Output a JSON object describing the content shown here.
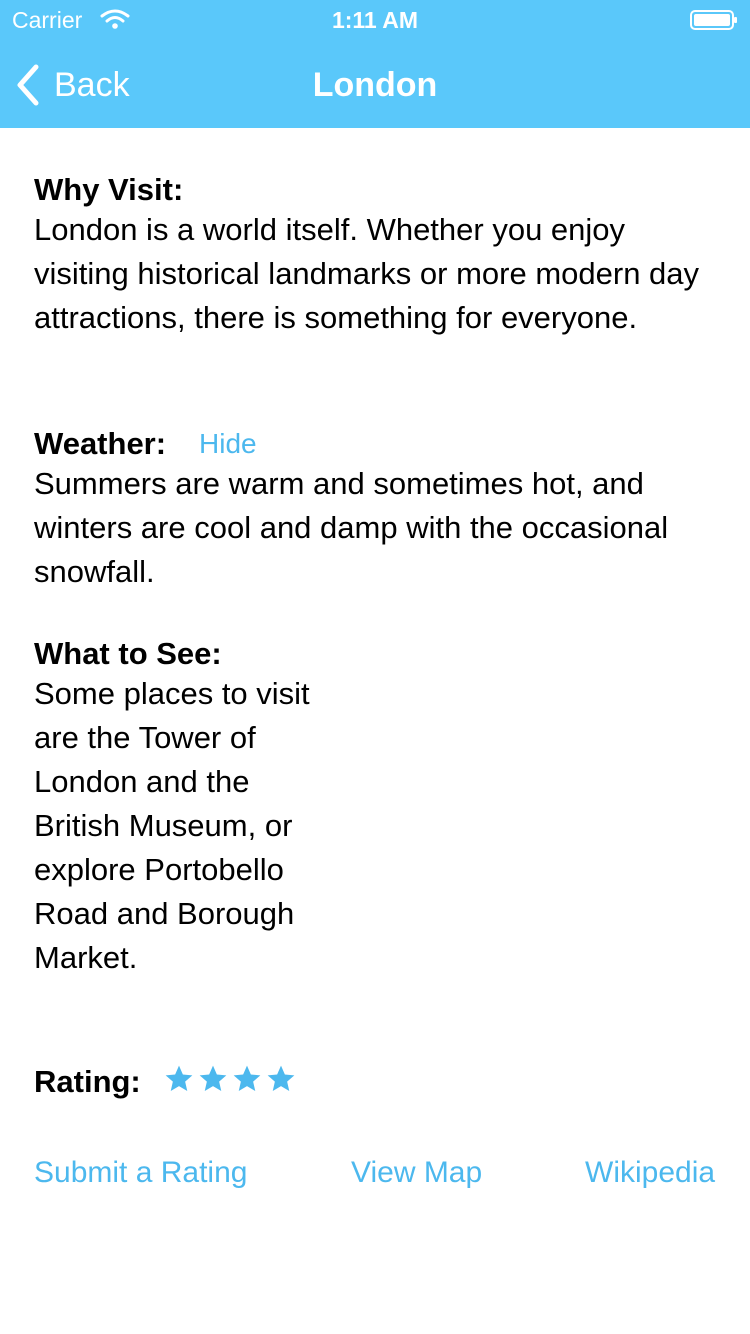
{
  "status_bar": {
    "carrier": "Carrier",
    "time": "1:11 AM",
    "wifi_icon": "wifi-icon",
    "battery_icon": "battery-icon"
  },
  "nav": {
    "back_label": "Back",
    "back_icon": "chevron-left-icon",
    "title": "London"
  },
  "sections": {
    "why_visit": {
      "heading": "Why Visit:",
      "text": "London is a world itself. Whether you enjoy visiting historical landmarks or more modern day attractions, there is something for everyone."
    },
    "weather": {
      "heading": "Weather:",
      "toggle_label": "Hide",
      "text": "Summers are warm and sometimes hot, and winters are cool and damp with the occasional snowfall."
    },
    "what_to_see": {
      "heading": "What to See:",
      "text": "Some places to visit are the Tower of London and the British Museum, or explore Portobello Road and Borough Market."
    },
    "rating": {
      "heading": "Rating:",
      "stars": 4,
      "star_icon": "star-icon"
    }
  },
  "actions": {
    "submit_rating": "Submit a Rating",
    "view_map": "View Map",
    "wikipedia": "Wikipedia"
  },
  "colors": {
    "header_bg": "#5ac8fa",
    "accent": "#4cb8ee",
    "text": "#000000"
  }
}
